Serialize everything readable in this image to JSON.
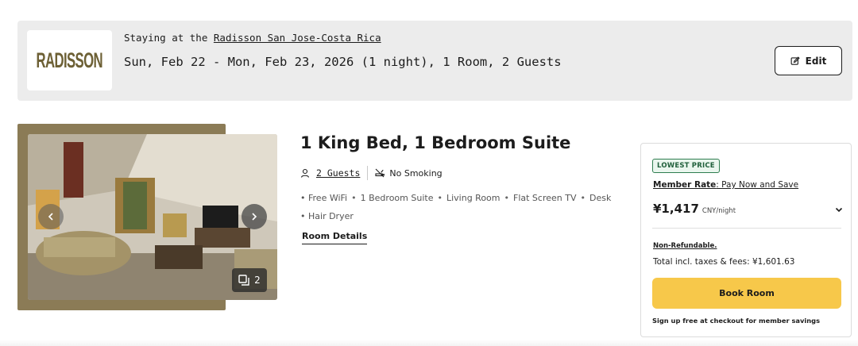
{
  "stay": {
    "logo_text": "RADISSON",
    "staying_prefix": "Staying at the ",
    "hotel_name": "Radisson San Jose-Costa Rica",
    "summary": "Sun, Feb 22 - Mon, Feb 23, 2026 (1 night), 1 Room, 2 Guests",
    "edit_label": "Edit",
    "edit_icon": "pencil-edit-icon"
  },
  "room": {
    "title": "1 King Bed, 1 Bedroom Suite",
    "guests_label": "2 Guests",
    "guests_icon": "person-icon",
    "smoking_label": "No Smoking",
    "smoking_icon": "no-smoking-icon",
    "amenities": [
      "Free WiFi",
      "1 Bedroom Suite",
      "Living Room",
      "Flat Screen TV",
      "Desk",
      "Hair Dryer"
    ],
    "amenity_separator": "•",
    "details_label": "Room Details",
    "photo_count": "2",
    "photo_icons": [
      "chevron-left-icon",
      "chevron-right-icon",
      "gallery-icon"
    ]
  },
  "rate": {
    "badge": "LOWEST PRICE",
    "member_rate_bold": "Member Rate",
    "member_rate_rest": ": Pay Now and Save",
    "price": "¥1,417",
    "price_unit": "CNY/night",
    "non_refundable": "Non-Refundable.",
    "total": "Total incl. taxes & fees: ¥1,601.63",
    "book_label": "Book Room",
    "signup_note": "Sign up free at checkout for member savings"
  },
  "colors": {
    "accent_yellow": "#f7c84a",
    "badge_green": "#2e7d4f",
    "brand_gold": "#6d6035",
    "frame_olive": "#8b7b56"
  }
}
